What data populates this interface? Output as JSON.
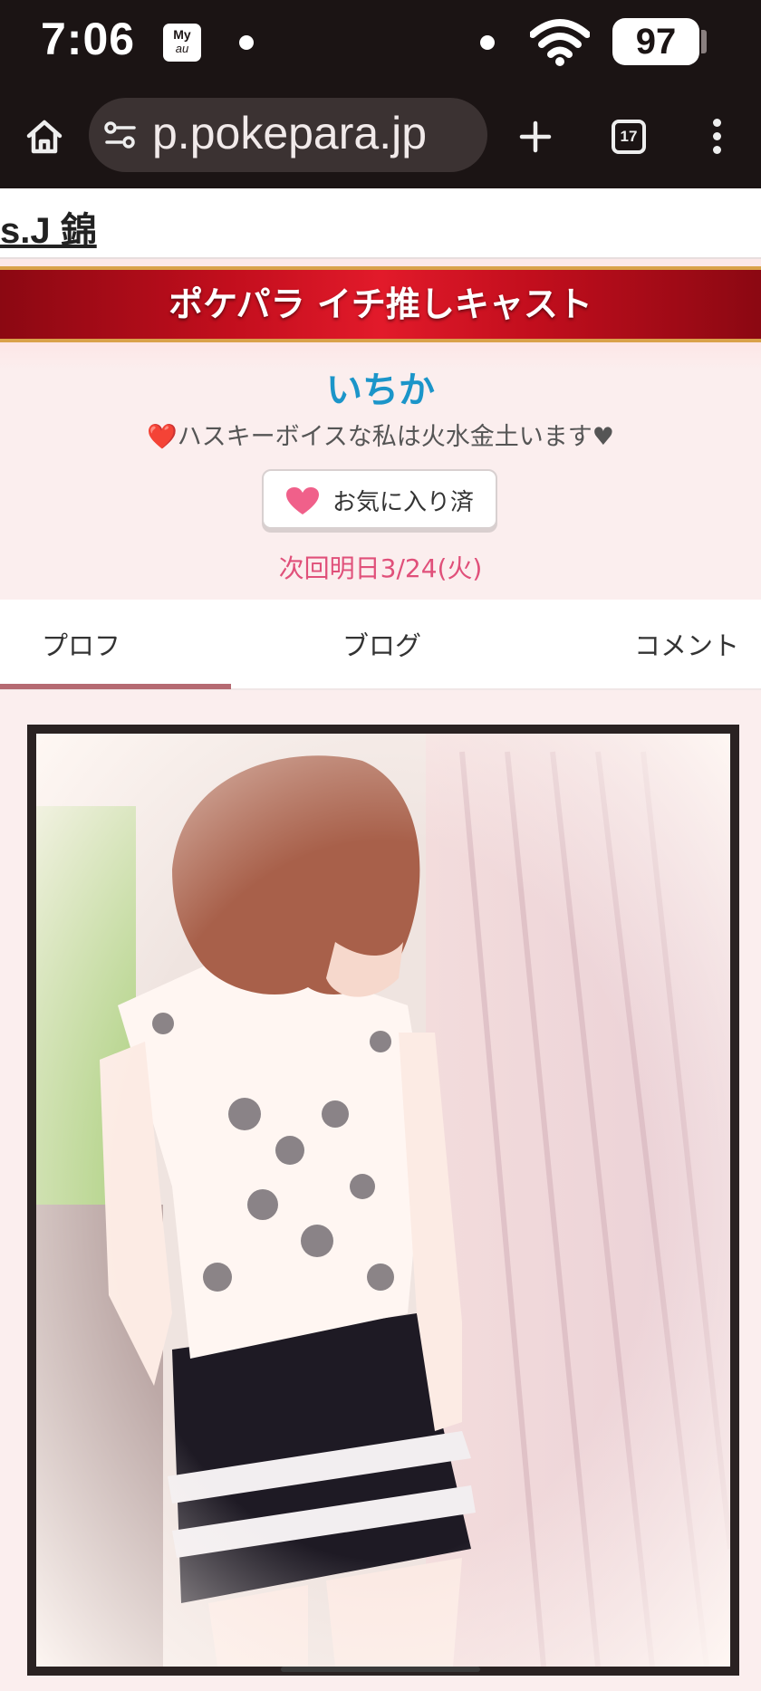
{
  "status_bar": {
    "time": "7:06",
    "carrier_icon_top": "My",
    "carrier_icon_bottom": "au",
    "battery": "97"
  },
  "browser": {
    "url": "p.pokepara.jp",
    "tab_count": "17"
  },
  "page": {
    "shop_name": "s.J 錦",
    "banner_title": "ポケパラ イチ推しキャスト",
    "cast": {
      "name": "いちか",
      "catchphrase": "❤️ハスキーボイスな私は火水金土います♥",
      "favorite_label": "お気に入り済",
      "next_attendance": "次回明日3/24(火)"
    },
    "tabs": [
      {
        "label": "プロフ",
        "active": true
      },
      {
        "label": "ブログ",
        "active": false
      },
      {
        "label": "コメント",
        "active": false
      }
    ]
  },
  "colors": {
    "cast_name": "#1b95c9",
    "next_date": "#e0507a",
    "banner_red": "#c20e1d",
    "tab_indicator": "#b56a72"
  },
  "icons": [
    "home-icon",
    "site-settings-icon",
    "plus-icon",
    "tab-switcher-icon",
    "more-vert-icon",
    "wifi-icon",
    "heart-icon"
  ]
}
